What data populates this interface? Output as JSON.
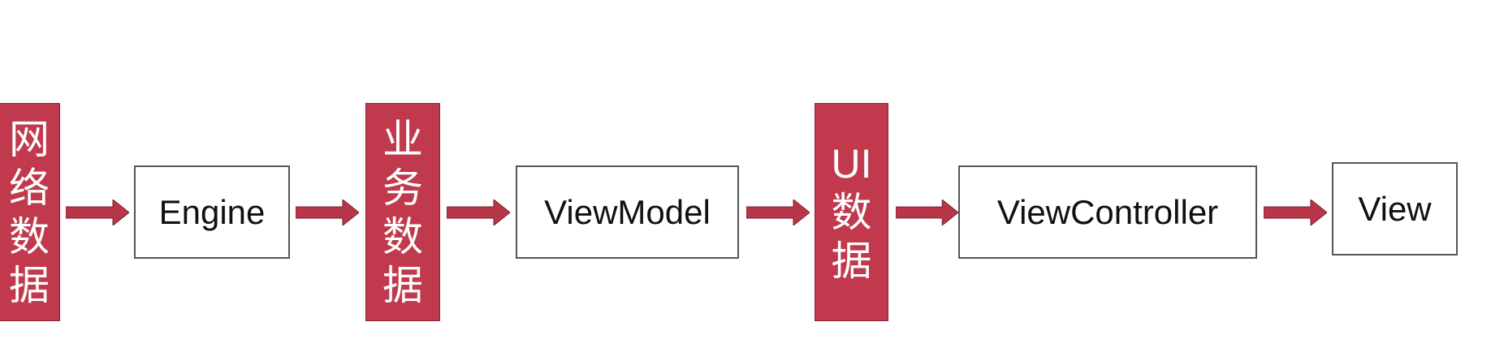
{
  "nodes": [
    {
      "id": "network-data",
      "label": [
        "网",
        "络",
        "数",
        "据"
      ],
      "style": "data"
    },
    {
      "id": "engine",
      "label": "Engine",
      "style": "component"
    },
    {
      "id": "business-data",
      "label": [
        "业",
        "务",
        "数",
        "据"
      ],
      "style": "data"
    },
    {
      "id": "viewmodel",
      "label": "ViewModel",
      "style": "component"
    },
    {
      "id": "ui-data",
      "label": [
        "UI",
        "数",
        "据"
      ],
      "style": "data"
    },
    {
      "id": "viewcontroller",
      "label": "ViewController",
      "style": "component"
    },
    {
      "id": "view",
      "label": "View",
      "style": "component"
    }
  ],
  "edges": [
    [
      "network-data",
      "engine"
    ],
    [
      "engine",
      "business-data"
    ],
    [
      "business-data",
      "viewmodel"
    ],
    [
      "viewmodel",
      "ui-data"
    ],
    [
      "ui-data",
      "viewcontroller"
    ],
    [
      "viewcontroller",
      "view"
    ]
  ],
  "colors": {
    "data_fill": "#c0394d",
    "arrow": "#b8364a",
    "component_border": "#555555"
  }
}
